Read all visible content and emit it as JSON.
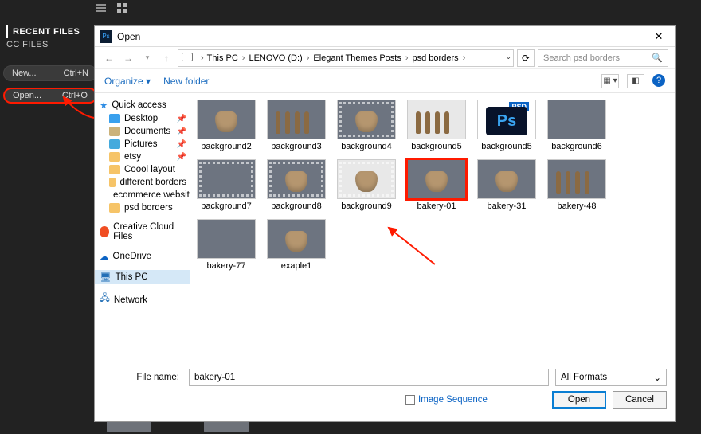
{
  "ps": {
    "tabs": {
      "recent": "RECENT FILES",
      "cc": "CC FILES"
    },
    "pills": {
      "new_label": "New...",
      "new_shortcut": "Ctrl+N",
      "open_label": "Open...",
      "open_shortcut": "Ctrl+O"
    }
  },
  "dialog": {
    "title": "Open",
    "close": "✕",
    "nav": {
      "back": "←",
      "fwd": "→",
      "up": "↑"
    },
    "breadcrumb": [
      "This PC",
      "LENOVO (D:)",
      "Elegant Themes Posts",
      "psd borders"
    ],
    "search_placeholder": "Search psd borders",
    "toolbar": {
      "organize": "Organize ▾",
      "newfolder": "New folder"
    },
    "filetype": "All Formats",
    "buttons": {
      "open": "Open",
      "cancel": "Cancel"
    },
    "fnlabel": "File name:",
    "fnvalue": "bakery-01",
    "image_sequence": "Image Sequence"
  },
  "sidebar": {
    "quick": "Quick access",
    "items": [
      {
        "label": "Desktop",
        "pin": true,
        "ico": "ico-desk"
      },
      {
        "label": "Documents",
        "pin": true,
        "ico": "ico-doc"
      },
      {
        "label": "Pictures",
        "pin": true,
        "ico": "ico-pic"
      },
      {
        "label": "etsy",
        "pin": true,
        "ico": "ico-folder"
      },
      {
        "label": "Coool layout",
        "pin": false,
        "ico": "ico-folder"
      },
      {
        "label": "different borders",
        "pin": false,
        "ico": "ico-folder"
      },
      {
        "label": "ecommerce website",
        "pin": false,
        "ico": "ico-folder"
      },
      {
        "label": "psd borders",
        "pin": false,
        "ico": "ico-folder"
      }
    ],
    "cc": "Creative Cloud Files",
    "onedrive": "OneDrive",
    "thispc": "This PC",
    "network": "Network"
  },
  "files": [
    {
      "label": "background2",
      "variant": "bread"
    },
    {
      "label": "background3",
      "variant": "spoons"
    },
    {
      "label": "background4",
      "variant": "bread-border"
    },
    {
      "label": "background5",
      "variant": "spoons-light"
    },
    {
      "label": "background5",
      "variant": "psd"
    },
    {
      "label": "background6",
      "variant": "plain"
    },
    {
      "label": "background7",
      "variant": "plain-border"
    },
    {
      "label": "background8",
      "variant": "bread-border"
    },
    {
      "label": "background9",
      "variant": "bread-border-light"
    },
    {
      "label": "bakery-01",
      "variant": "bread",
      "selected": true
    },
    {
      "label": "bakery-31",
      "variant": "bread"
    },
    {
      "label": "bakery-48",
      "variant": "spoons"
    },
    {
      "label": "bakery-77",
      "variant": "plain"
    },
    {
      "label": "exaple1",
      "variant": "bread"
    }
  ]
}
